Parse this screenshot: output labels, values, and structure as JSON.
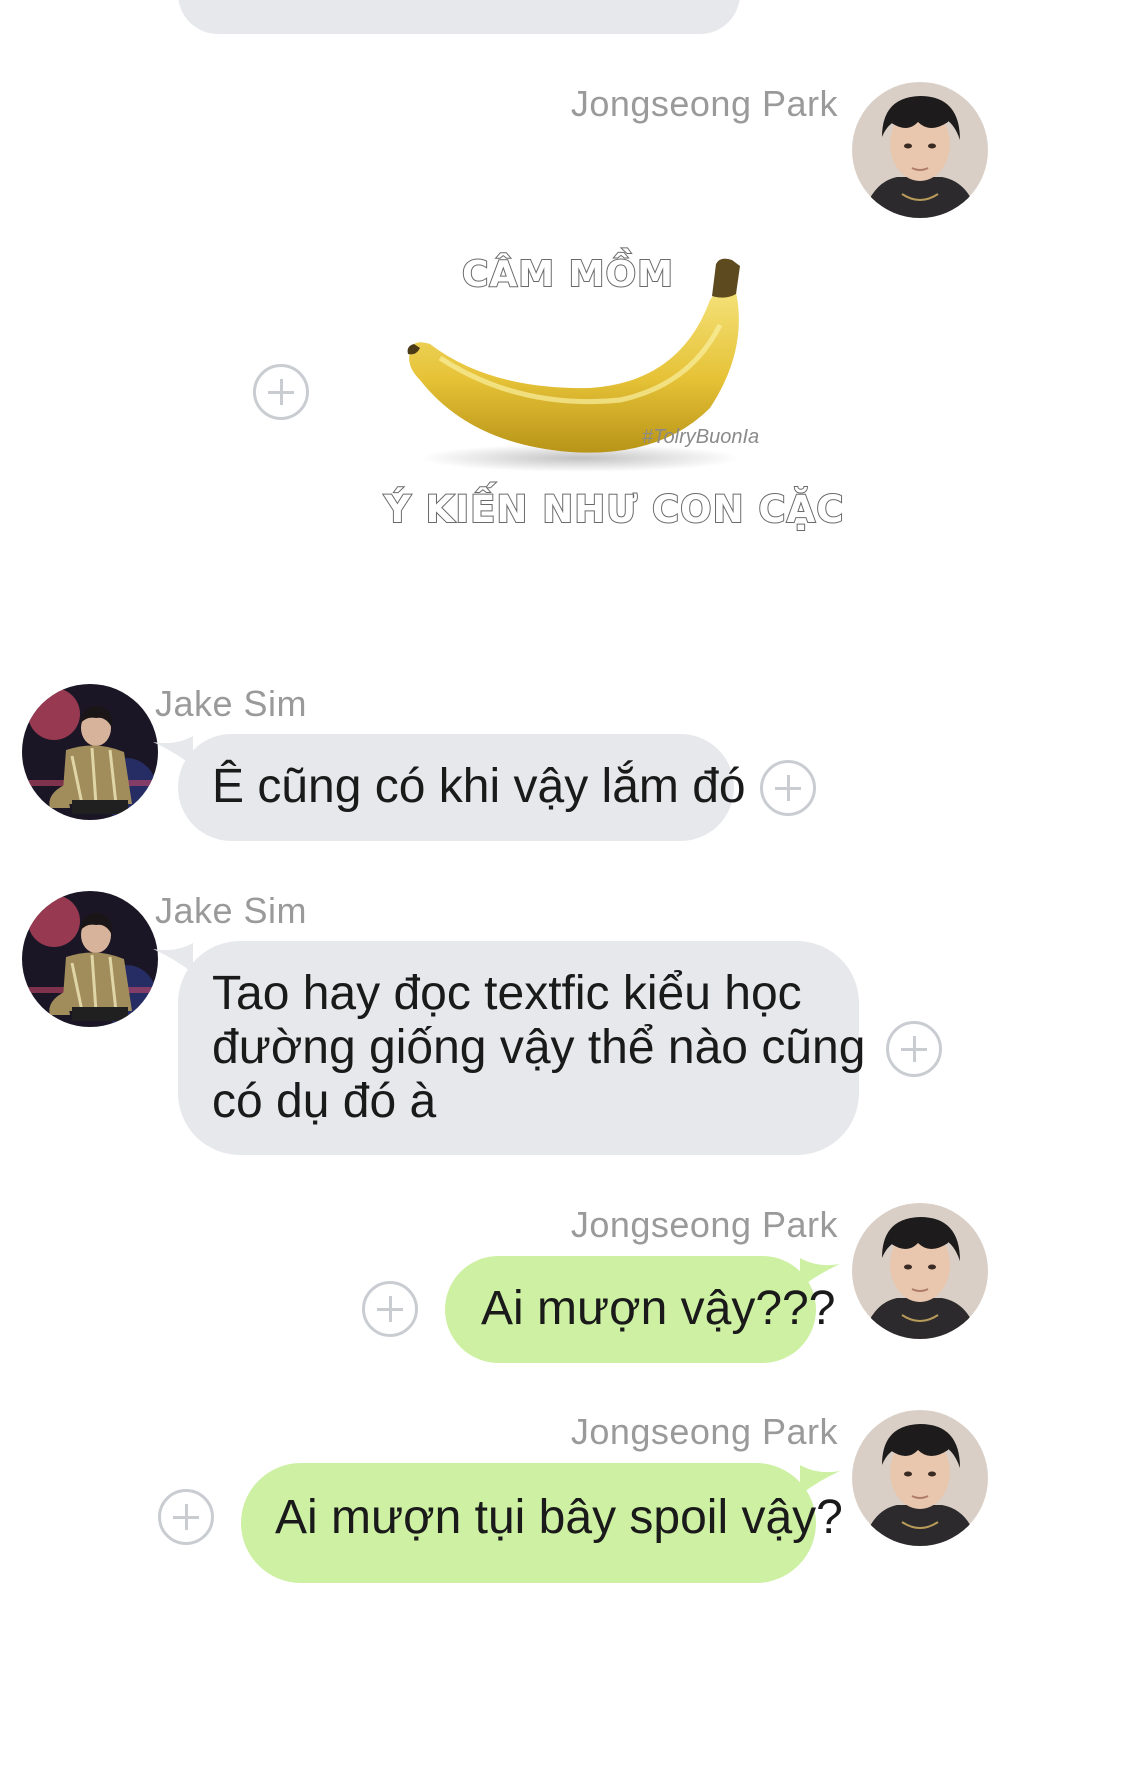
{
  "messages": [
    {
      "sender": "Jongseong Park",
      "type": "sticker",
      "sticker": {
        "top_text": "CÂM MỒM",
        "bottom_text": "Ý KIẾN NHƯ CON CẶC",
        "watermark": "#TolryBuonIa"
      }
    },
    {
      "sender": "Jake Sim",
      "type": "text",
      "text": "Ê cũng có khi vậy lắm đó"
    },
    {
      "sender": "Jake Sim",
      "type": "text",
      "lines": [
        "Tao hay đọc textfic kiểu học",
        "đường giống vậy thể nào cũng",
        "có dụ đó à"
      ]
    },
    {
      "sender": "Jongseong Park",
      "type": "text",
      "text": "Ai mượn vậy???"
    },
    {
      "sender": "Jongseong Park",
      "type": "text",
      "text": "Ai mượn tụi bây spoil vậy?"
    }
  ],
  "colors": {
    "incoming_bubble": "#e6e8eb",
    "outgoing_bubble": "#cdf0a3",
    "sender_name": "#9a9a9a",
    "add_reaction_icon": "#c9ccd1"
  },
  "icons": {
    "add_reaction": "plus-circle-icon",
    "avatar_park": "avatar-image",
    "avatar_sim": "avatar-image"
  }
}
